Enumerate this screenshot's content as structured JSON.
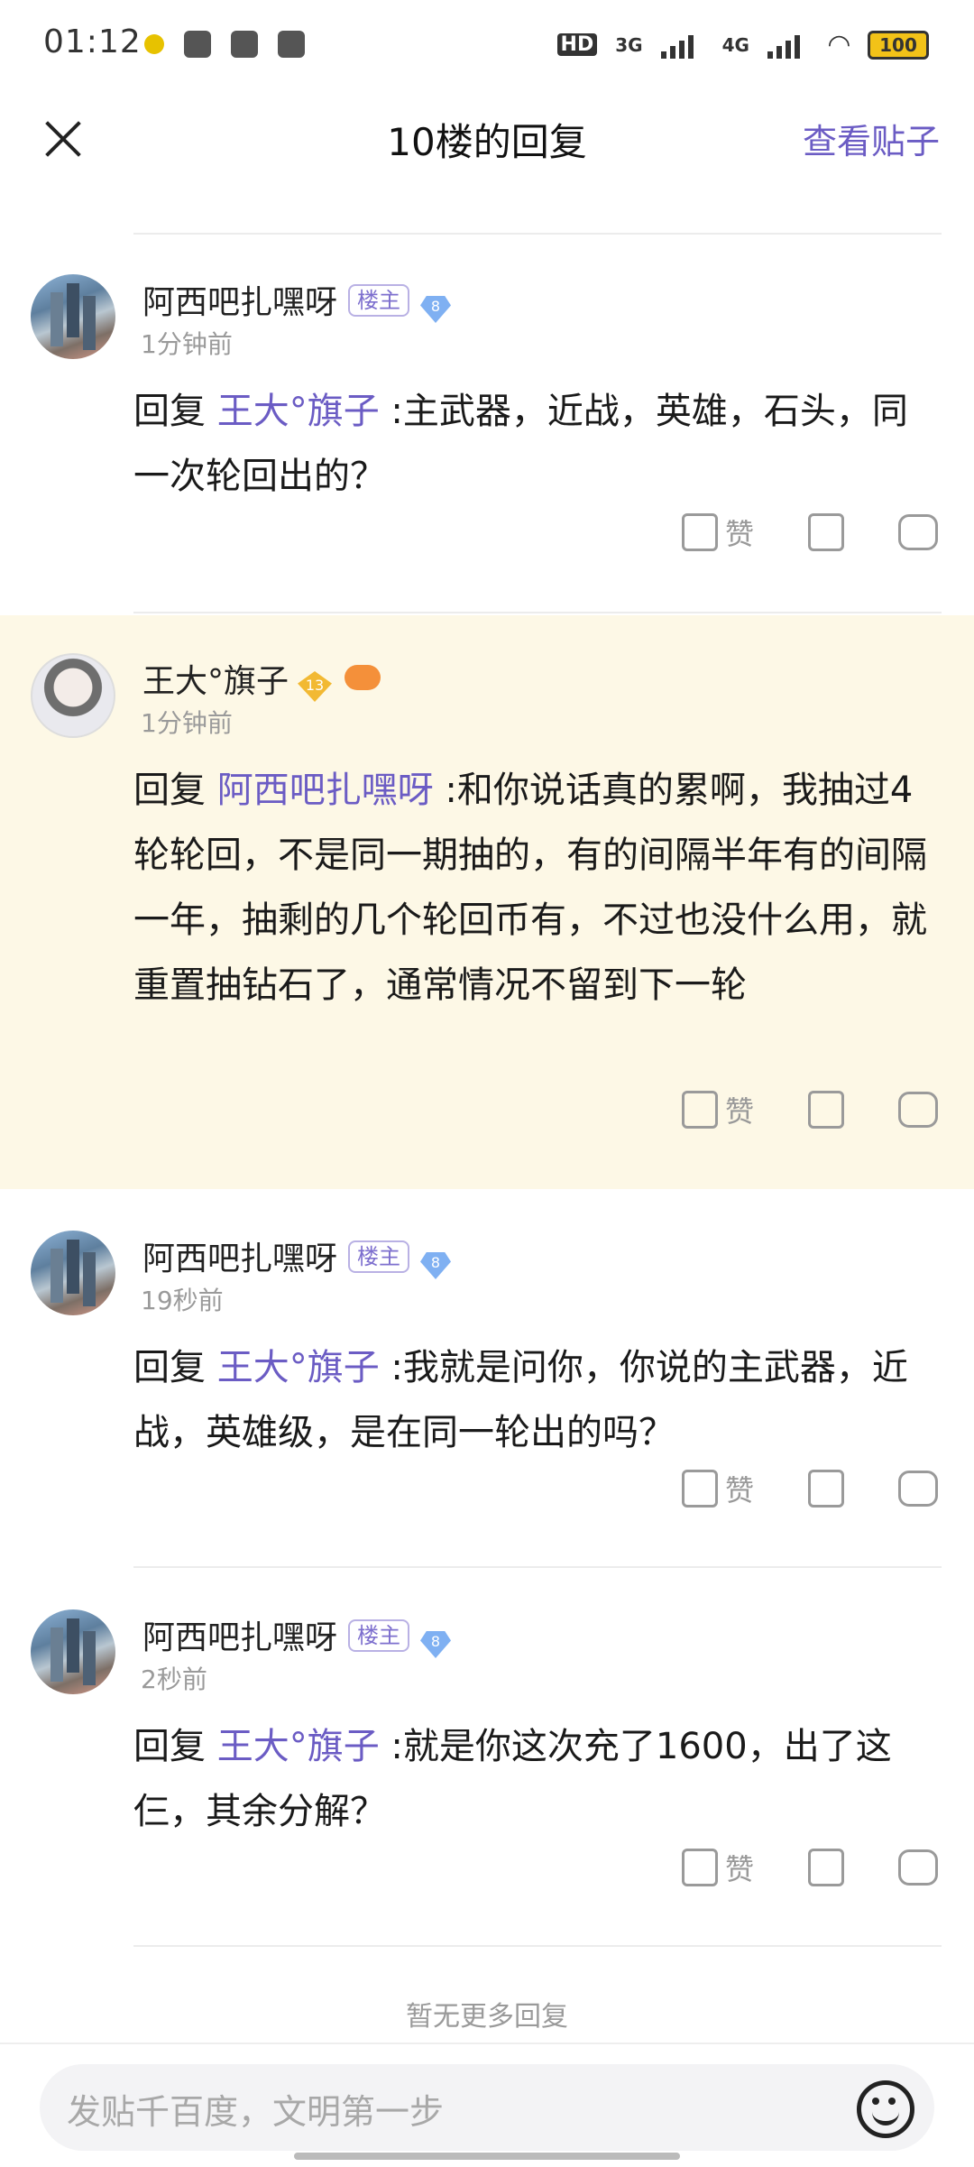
{
  "status_bar": {
    "time": "01:12",
    "network1": "3G",
    "network2": "4G",
    "battery": "100"
  },
  "header": {
    "title": "10楼的回复",
    "view_post": "查看贴子"
  },
  "labels": {
    "host_badge": "楼主",
    "like": "赞",
    "reply_prefix": "回复"
  },
  "replies": [
    {
      "username": "阿西吧扎嘿呀",
      "is_host": true,
      "level": "8",
      "time": "1分钟前",
      "mention": "王大°旗子",
      "text": " :主武器，近战，英雄，石头，同一次轮回出的？"
    },
    {
      "username": "王大°旗子",
      "is_host": false,
      "level": "13",
      "time": "1分钟前",
      "mention": "阿西吧扎嘿呀",
      "text": " :和你说话真的累啊，我抽过4轮轮回，不是同一期抽的，有的间隔半年有的间隔一年，抽剩的几个轮回币有，不过也没什么用，就重置抽钻石了，通常情况不留到下一轮"
    },
    {
      "username": "阿西吧扎嘿呀",
      "is_host": true,
      "level": "8",
      "time": "19秒前",
      "mention": "王大°旗子",
      "text": " :我就是问你，你说的主武器，近战，英雄级，是在同一轮出的吗？"
    },
    {
      "username": "阿西吧扎嘿呀",
      "is_host": true,
      "level": "8",
      "time": "2秒前",
      "mention": "王大°旗子",
      "text": " :就是你这次充了1600，出了这仨，其余分解？"
    }
  ],
  "footer": {
    "no_more": "暂无更多回复",
    "input_placeholder": "发贴千百度，文明第一步"
  }
}
